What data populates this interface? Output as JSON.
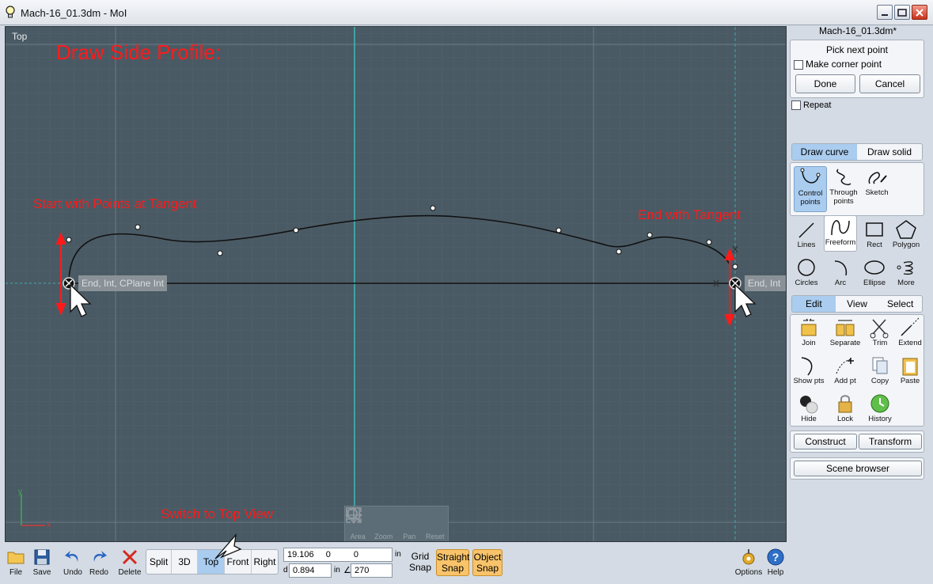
{
  "window": {
    "title": "Mach-16_01.3dm - MoI"
  },
  "viewport": {
    "label": "Top",
    "annotations": {
      "heading": "Draw Side Profile:",
      "start": "Start with Points at Tangent",
      "end": "End with Tangent",
      "switch_view": "Switch to Top View"
    },
    "snap_left": "End, Int, CPlane Int",
    "snap_right": "End, Int",
    "axis_y": "y",
    "axis_x": "x",
    "nav_tools": [
      "Area",
      "Zoom",
      "Pan",
      "Reset"
    ]
  },
  "bottom_toolbar": {
    "file": "File",
    "save": "Save",
    "undo": "Undo",
    "redo": "Redo",
    "delete": "Delete",
    "views": [
      "Split",
      "3D",
      "Top",
      "Front",
      "Right"
    ],
    "active_view": "Top",
    "coord_x": "19.106",
    "coord_y": "0",
    "coord_z": "0",
    "unit": "in",
    "dist_prefix": "d",
    "distance": "0.894",
    "dist_unit": "in",
    "angle_symbol": "∠",
    "angle": "270",
    "grid_snap": "Grid Snap",
    "straight_snap": "Straight Snap",
    "object_snap": "Object Snap",
    "options": "Options",
    "help": "Help"
  },
  "panel": {
    "file_name": "Mach-16_01.3dm*",
    "prompt": "Pick next point",
    "corner_label": "Make corner point",
    "done": "Done",
    "cancel": "Cancel",
    "repeat": "Repeat",
    "draw_tabs": [
      "Draw curve",
      "Draw solid"
    ],
    "curve_tools": [
      "Control points",
      "Through points",
      "Sketch"
    ],
    "shape_tools": [
      "Lines",
      "Freeform",
      "Rect",
      "Polygon",
      "Circles",
      "Arc",
      "Ellipse",
      "More"
    ],
    "edit_tabs": [
      "Edit",
      "View",
      "Select"
    ],
    "edit_tools": [
      "Join",
      "Separate",
      "Trim",
      "Extend",
      "Show pts",
      "Add pt",
      "Copy",
      "Paste",
      "Hide",
      "Lock",
      "History"
    ],
    "construct": "Construct",
    "transform": "Transform",
    "scene_browser": "Scene browser"
  }
}
